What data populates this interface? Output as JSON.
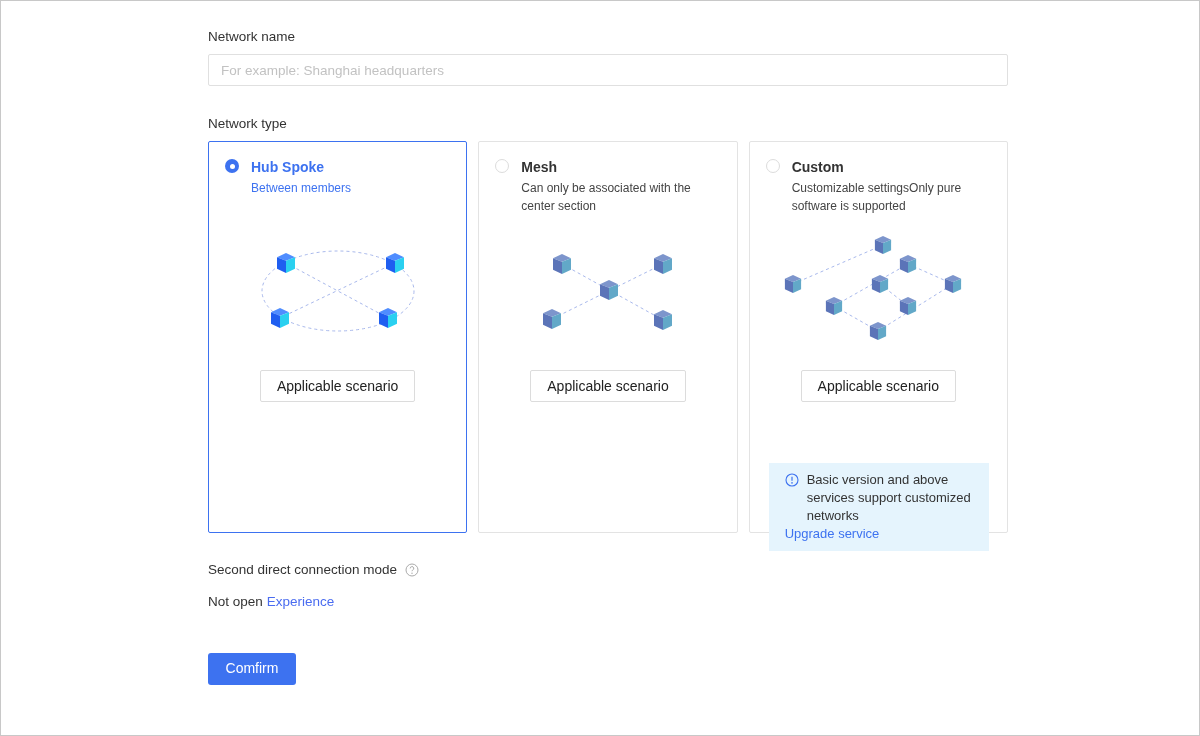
{
  "network_name": {
    "label": "Network name",
    "placeholder": "For example: Shanghai headquarters"
  },
  "network_type": {
    "label": "Network type",
    "options": [
      {
        "kind": "hub",
        "title": "Hub Spoke",
        "description": "Between members",
        "selected": true,
        "button": "Applicable scenario"
      },
      {
        "kind": "mesh",
        "title": "Mesh",
        "description": "Can only be associated with the center section",
        "selected": false,
        "button": "Applicable scenario"
      },
      {
        "kind": "custom",
        "title": "Custom",
        "description": "Customizable settingsOnly pure software is supported",
        "selected": false,
        "button": "Applicable scenario",
        "notice": {
          "text": "Basic version and above services support customized networks",
          "link": "Upgrade service"
        }
      }
    ]
  },
  "second_mode": {
    "label": "Second direct connection mode",
    "status": "Not open",
    "link": "Experience"
  },
  "confirm_button": "Comfirm"
}
